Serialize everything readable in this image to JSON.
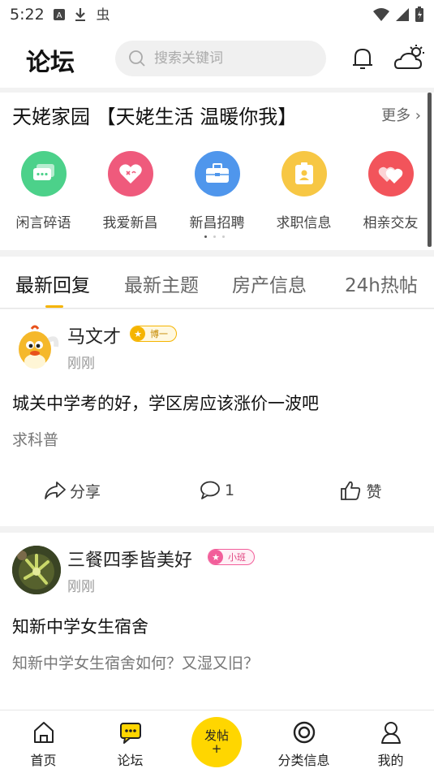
{
  "status_bar": {
    "time": "5:22",
    "icons": [
      "a-icon",
      "download-icon",
      "bug-icon",
      "wifi-icon",
      "signal-icon",
      "battery-icon"
    ]
  },
  "header": {
    "title": "论坛",
    "search_placeholder": "搜索关键词",
    "icons": [
      "bell-icon",
      "weather-icon"
    ]
  },
  "featured": {
    "heading": "天姥家园 【天姥生活 温暖你我】",
    "more_label": "更多",
    "categories": [
      {
        "label": "闲言碎语",
        "color": "#4cd18a",
        "icon": "chat-icon"
      },
      {
        "label": "我爱新昌",
        "color": "#ef5a7c",
        "icon": "heart-icon"
      },
      {
        "label": "新昌招聘",
        "color": "#4f96ec",
        "icon": "briefcase-icon"
      },
      {
        "label": "求职信息",
        "color": "#f7c744",
        "icon": "badge-icon"
      },
      {
        "label": "相亲交友",
        "color": "#f2545b",
        "icon": "hearts-icon"
      }
    ]
  },
  "tabs": [
    {
      "label": "最新回复"
    },
    {
      "label": "最新主题"
    },
    {
      "label": "房产信息"
    },
    {
      "label": "24h热帖"
    }
  ],
  "posts": [
    {
      "author": "马文才",
      "badge": "博一",
      "badge_color": "#f5b400",
      "time": "刚刚",
      "subject": "城关中学考的好，学区房应该涨价一波吧",
      "body": "求科普",
      "share_label": "分享",
      "comment_count": "1",
      "like_label": "赞"
    },
    {
      "author": "三餐四季皆美好",
      "badge": "小班",
      "badge_color": "#f25e9a",
      "time": "刚刚",
      "subject": "知新中学女生宿舍",
      "body": "知新中学女生宿舍如何？又湿又旧？"
    }
  ],
  "bottom_nav": {
    "items": [
      {
        "label": "首页",
        "icon": "home-icon"
      },
      {
        "label": "论坛",
        "icon": "forum-icon"
      },
      {
        "label": "分类信息",
        "icon": "target-icon"
      },
      {
        "label": "我的",
        "icon": "user-icon"
      }
    ],
    "fab_label": "发帖",
    "fab_plus": "+"
  }
}
